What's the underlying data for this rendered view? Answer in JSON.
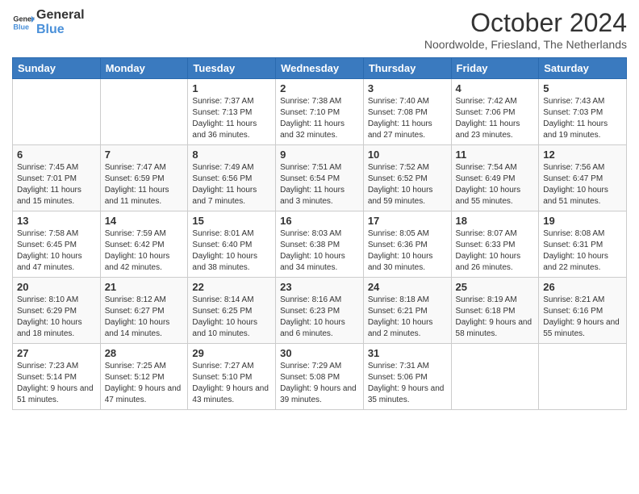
{
  "header": {
    "logo_line1": "General",
    "logo_line2": "Blue",
    "month": "October 2024",
    "location": "Noordwolde, Friesland, The Netherlands"
  },
  "days_of_week": [
    "Sunday",
    "Monday",
    "Tuesday",
    "Wednesday",
    "Thursday",
    "Friday",
    "Saturday"
  ],
  "weeks": [
    [
      {
        "day": "",
        "info": ""
      },
      {
        "day": "",
        "info": ""
      },
      {
        "day": "1",
        "info": "Sunrise: 7:37 AM\nSunset: 7:13 PM\nDaylight: 11 hours and 36 minutes."
      },
      {
        "day": "2",
        "info": "Sunrise: 7:38 AM\nSunset: 7:10 PM\nDaylight: 11 hours and 32 minutes."
      },
      {
        "day": "3",
        "info": "Sunrise: 7:40 AM\nSunset: 7:08 PM\nDaylight: 11 hours and 27 minutes."
      },
      {
        "day": "4",
        "info": "Sunrise: 7:42 AM\nSunset: 7:06 PM\nDaylight: 11 hours and 23 minutes."
      },
      {
        "day": "5",
        "info": "Sunrise: 7:43 AM\nSunset: 7:03 PM\nDaylight: 11 hours and 19 minutes."
      }
    ],
    [
      {
        "day": "6",
        "info": "Sunrise: 7:45 AM\nSunset: 7:01 PM\nDaylight: 11 hours and 15 minutes."
      },
      {
        "day": "7",
        "info": "Sunrise: 7:47 AM\nSunset: 6:59 PM\nDaylight: 11 hours and 11 minutes."
      },
      {
        "day": "8",
        "info": "Sunrise: 7:49 AM\nSunset: 6:56 PM\nDaylight: 11 hours and 7 minutes."
      },
      {
        "day": "9",
        "info": "Sunrise: 7:51 AM\nSunset: 6:54 PM\nDaylight: 11 hours and 3 minutes."
      },
      {
        "day": "10",
        "info": "Sunrise: 7:52 AM\nSunset: 6:52 PM\nDaylight: 10 hours and 59 minutes."
      },
      {
        "day": "11",
        "info": "Sunrise: 7:54 AM\nSunset: 6:49 PM\nDaylight: 10 hours and 55 minutes."
      },
      {
        "day": "12",
        "info": "Sunrise: 7:56 AM\nSunset: 6:47 PM\nDaylight: 10 hours and 51 minutes."
      }
    ],
    [
      {
        "day": "13",
        "info": "Sunrise: 7:58 AM\nSunset: 6:45 PM\nDaylight: 10 hours and 47 minutes."
      },
      {
        "day": "14",
        "info": "Sunrise: 7:59 AM\nSunset: 6:42 PM\nDaylight: 10 hours and 42 minutes."
      },
      {
        "day": "15",
        "info": "Sunrise: 8:01 AM\nSunset: 6:40 PM\nDaylight: 10 hours and 38 minutes."
      },
      {
        "day": "16",
        "info": "Sunrise: 8:03 AM\nSunset: 6:38 PM\nDaylight: 10 hours and 34 minutes."
      },
      {
        "day": "17",
        "info": "Sunrise: 8:05 AM\nSunset: 6:36 PM\nDaylight: 10 hours and 30 minutes."
      },
      {
        "day": "18",
        "info": "Sunrise: 8:07 AM\nSunset: 6:33 PM\nDaylight: 10 hours and 26 minutes."
      },
      {
        "day": "19",
        "info": "Sunrise: 8:08 AM\nSunset: 6:31 PM\nDaylight: 10 hours and 22 minutes."
      }
    ],
    [
      {
        "day": "20",
        "info": "Sunrise: 8:10 AM\nSunset: 6:29 PM\nDaylight: 10 hours and 18 minutes."
      },
      {
        "day": "21",
        "info": "Sunrise: 8:12 AM\nSunset: 6:27 PM\nDaylight: 10 hours and 14 minutes."
      },
      {
        "day": "22",
        "info": "Sunrise: 8:14 AM\nSunset: 6:25 PM\nDaylight: 10 hours and 10 minutes."
      },
      {
        "day": "23",
        "info": "Sunrise: 8:16 AM\nSunset: 6:23 PM\nDaylight: 10 hours and 6 minutes."
      },
      {
        "day": "24",
        "info": "Sunrise: 8:18 AM\nSunset: 6:21 PM\nDaylight: 10 hours and 2 minutes."
      },
      {
        "day": "25",
        "info": "Sunrise: 8:19 AM\nSunset: 6:18 PM\nDaylight: 9 hours and 58 minutes."
      },
      {
        "day": "26",
        "info": "Sunrise: 8:21 AM\nSunset: 6:16 PM\nDaylight: 9 hours and 55 minutes."
      }
    ],
    [
      {
        "day": "27",
        "info": "Sunrise: 7:23 AM\nSunset: 5:14 PM\nDaylight: 9 hours and 51 minutes."
      },
      {
        "day": "28",
        "info": "Sunrise: 7:25 AM\nSunset: 5:12 PM\nDaylight: 9 hours and 47 minutes."
      },
      {
        "day": "29",
        "info": "Sunrise: 7:27 AM\nSunset: 5:10 PM\nDaylight: 9 hours and 43 minutes."
      },
      {
        "day": "30",
        "info": "Sunrise: 7:29 AM\nSunset: 5:08 PM\nDaylight: 9 hours and 39 minutes."
      },
      {
        "day": "31",
        "info": "Sunrise: 7:31 AM\nSunset: 5:06 PM\nDaylight: 9 hours and 35 minutes."
      },
      {
        "day": "",
        "info": ""
      },
      {
        "day": "",
        "info": ""
      }
    ]
  ]
}
